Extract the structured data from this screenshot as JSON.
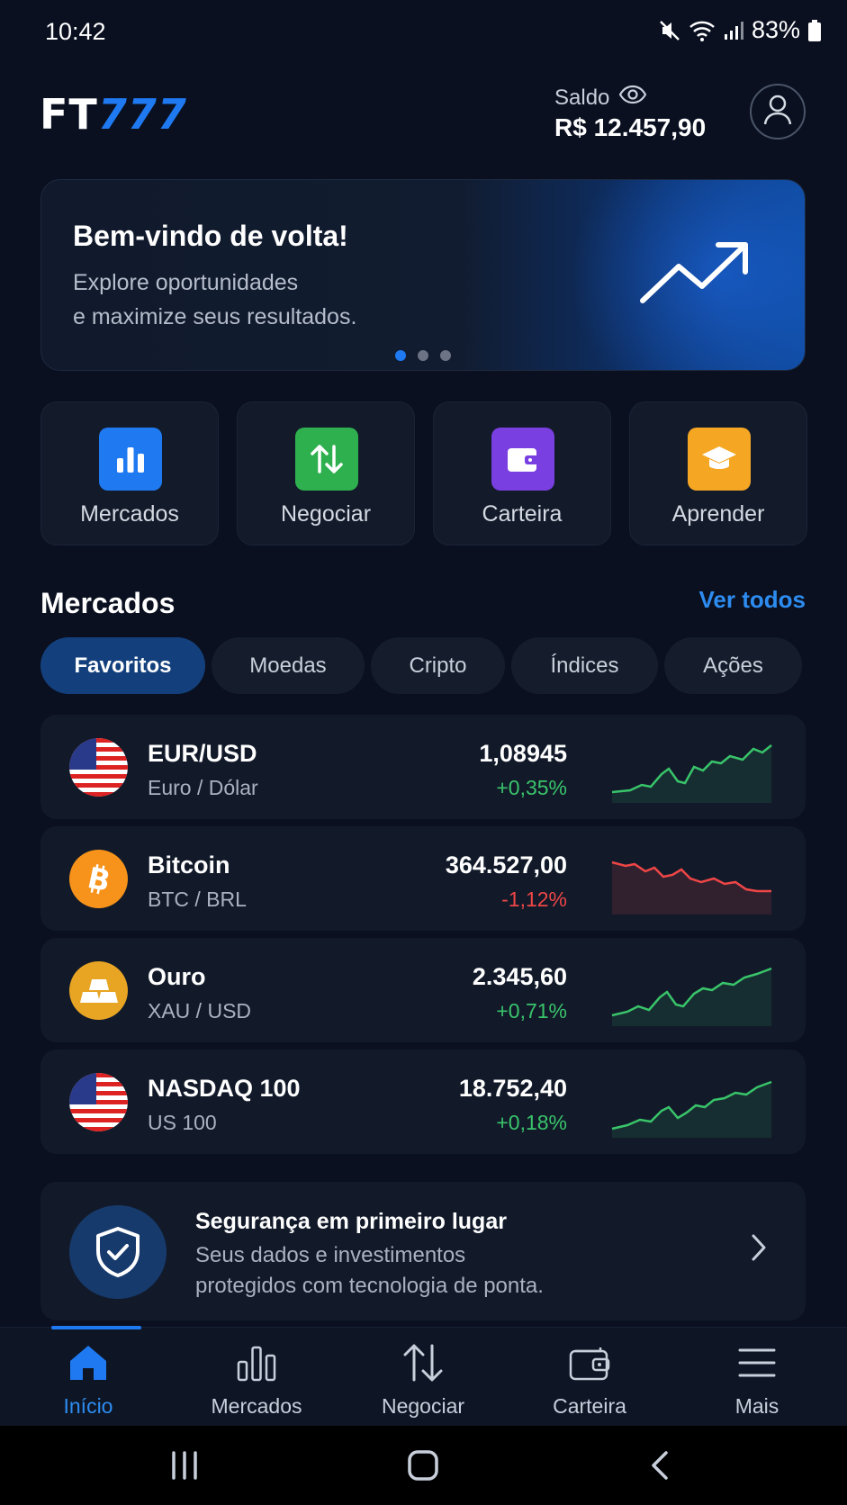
{
  "status_bar": {
    "time": "10:42",
    "battery": "83%"
  },
  "header": {
    "logo_ft": "FT",
    "logo_num": "777",
    "saldo_label": "Saldo",
    "saldo_value": "R$ 12.457,90"
  },
  "hero": {
    "title": "Bem-vindo de volta!",
    "subtitle_line1": "Explore oportunidades",
    "subtitle_line2": "e maximize seus resultados.",
    "slides": 3,
    "active_slide": 1
  },
  "quick_actions": [
    {
      "label": "Mercados",
      "icon": "bar-chart-icon",
      "color": "#1f7af2"
    },
    {
      "label": "Negociar",
      "icon": "swap-arrows-icon",
      "color": "#2fb04f"
    },
    {
      "label": "Carteira",
      "icon": "wallet-icon",
      "color": "#7a3fe0"
    },
    {
      "label": "Aprender",
      "icon": "graduation-cap-icon",
      "color": "#f5a623"
    }
  ],
  "markets": {
    "title": "Mercados",
    "see_all": "Ver todos",
    "tabs": [
      "Favoritos",
      "Moedas",
      "Cripto",
      "Índices",
      "Ações"
    ],
    "active_tab": "Favoritos",
    "rows": [
      {
        "name": "EUR/USD",
        "sub": "Euro / Dólar",
        "price": "1,08945",
        "change": "+0,35%",
        "trend": "up",
        "icon": "us-flag-icon"
      },
      {
        "name": "Bitcoin",
        "sub": "BTC / BRL",
        "price": "364.527,00",
        "change": "-1,12%",
        "trend": "down",
        "icon": "bitcoin-icon"
      },
      {
        "name": "Ouro",
        "sub": "XAU / USD",
        "price": "2.345,60",
        "change": "+0,71%",
        "trend": "up",
        "icon": "gold-bars-icon"
      },
      {
        "name": "NASDAQ 100",
        "sub": "US 100",
        "price": "18.752,40",
        "change": "+0,18%",
        "trend": "up",
        "icon": "us-flag-icon"
      }
    ]
  },
  "security": {
    "title": "Segurança em primeiro lugar",
    "line1": "Seus dados e investimentos",
    "line2": "protegidos com tecnologia de ponta."
  },
  "bottom_nav": [
    {
      "label": "Início",
      "icon": "home-icon",
      "active": true
    },
    {
      "label": "Mercados",
      "icon": "bar-chart-icon",
      "active": false
    },
    {
      "label": "Negociar",
      "icon": "swap-arrows-icon",
      "active": false
    },
    {
      "label": "Carteira",
      "icon": "wallet-icon",
      "active": false
    },
    {
      "label": "Mais",
      "icon": "menu-icon",
      "active": false
    }
  ],
  "colors": {
    "accent": "#1f7af2",
    "positive": "#39c46a",
    "negative": "#ef4646",
    "background": "#0a1020"
  }
}
